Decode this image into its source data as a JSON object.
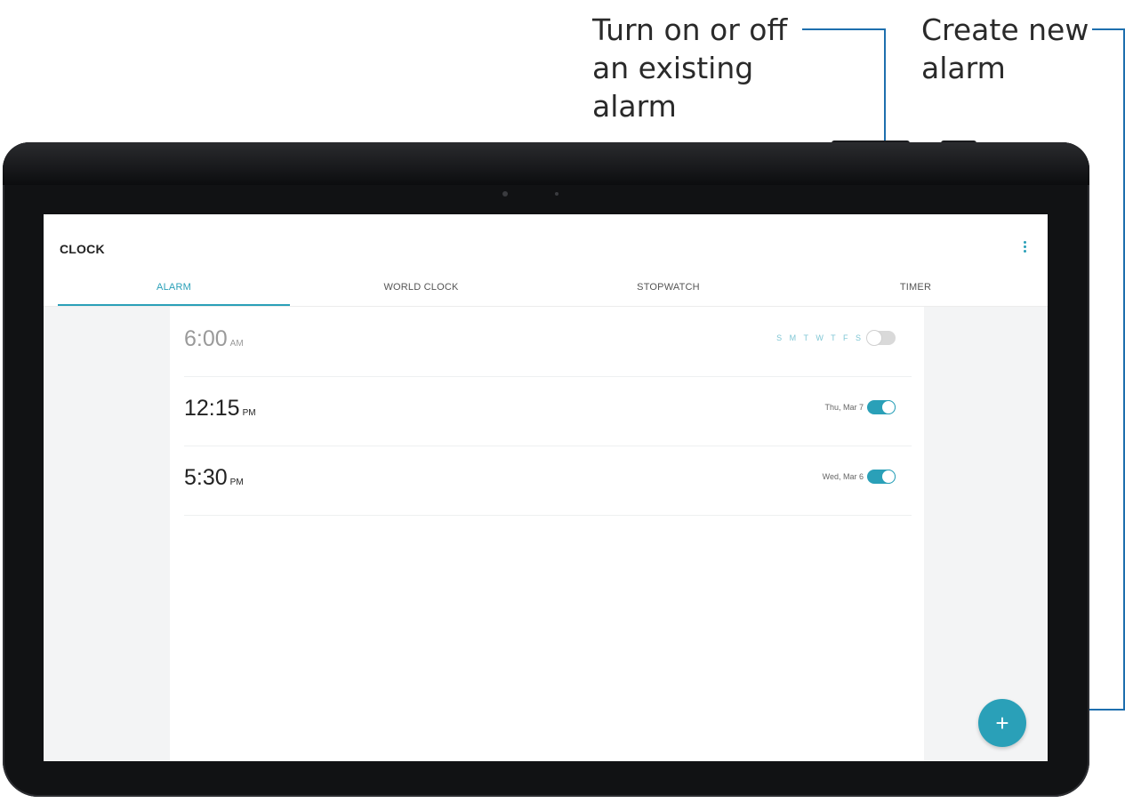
{
  "callouts": {
    "toggle_label": "Turn on or off an existing alarm",
    "create_label": "Create new alarm"
  },
  "app": {
    "title": "CLOCK",
    "menu_icon": "more-vert-icon"
  },
  "tabs": [
    {
      "label": "ALARM",
      "active": true
    },
    {
      "label": "WORLD CLOCK",
      "active": false
    },
    {
      "label": "STOPWATCH",
      "active": false
    },
    {
      "label": "TIMER",
      "active": false
    }
  ],
  "alarms": [
    {
      "time": "6:00",
      "ampm": "AM",
      "days": "S M T W T F S",
      "date": "",
      "enabled": false
    },
    {
      "time": "12:15",
      "ampm": "PM",
      "days": "",
      "date": "Thu, Mar 7",
      "enabled": true
    },
    {
      "time": "5:30",
      "ampm": "PM",
      "days": "",
      "date": "Wed, Mar 6",
      "enabled": true
    }
  ],
  "fab": {
    "label": "+",
    "icon": "add-icon"
  },
  "colors": {
    "accent": "#2aa0b8",
    "tablet": "#111214",
    "callout_line": "#1e6fae"
  }
}
